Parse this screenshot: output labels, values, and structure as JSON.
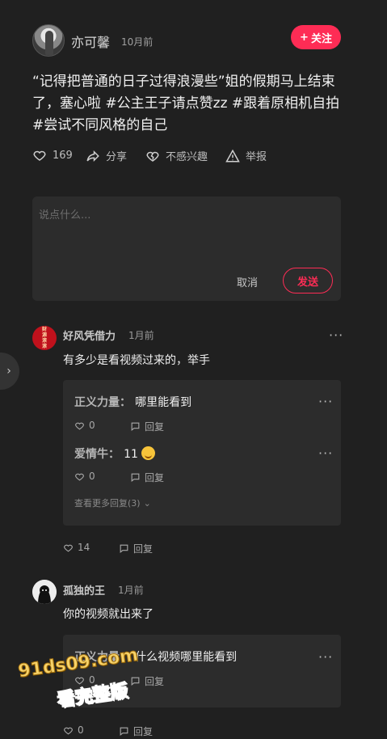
{
  "post": {
    "author": "亦可馨",
    "time": "10月前",
    "follow_label": "关注",
    "text": "“记得把普通的日子过得浪漫些”姐的假期马上结束了，塞心啦 #公主王子请点赞zz #跟着原相机自拍 #尝试不同风格的自己",
    "actions": {
      "like_count": "169",
      "share": "分享",
      "dislike": "不感兴趣",
      "report": "举报"
    }
  },
  "comment_box": {
    "placeholder": "说点什么...",
    "cancel": "取消",
    "send": "发送"
  },
  "comments": [
    {
      "user": "好风凭借力",
      "avatar_text": [
        "财",
        "源",
        "滚",
        "滚"
      ],
      "time": "1月前",
      "text": "有多少是看视频过来的，举手",
      "likes": "14",
      "reply_label": "回复",
      "replies": [
        {
          "user": "正义力量：",
          "text": "哪里能看到",
          "likes": "0",
          "reply_label": "回复"
        },
        {
          "user": "爱情牛：",
          "text": "11",
          "likes": "0",
          "reply_label": "回复"
        }
      ],
      "see_more": "查看更多回复(3)"
    },
    {
      "user": "孤独的王",
      "time": "1月前",
      "text": "你的视频就出来了",
      "likes": "0",
      "reply_label": "回复",
      "replies": [
        {
          "user": "正义力量：",
          "text": "什么视频哪里能看到",
          "likes": "0",
          "reply_label": "回复"
        }
      ]
    }
  ],
  "watermark": {
    "line1": "91ds09.com",
    "line2": "看完整版"
  },
  "colors": {
    "background": "#202020",
    "accent": "#fe2c55",
    "card": "#2c2c2c"
  }
}
